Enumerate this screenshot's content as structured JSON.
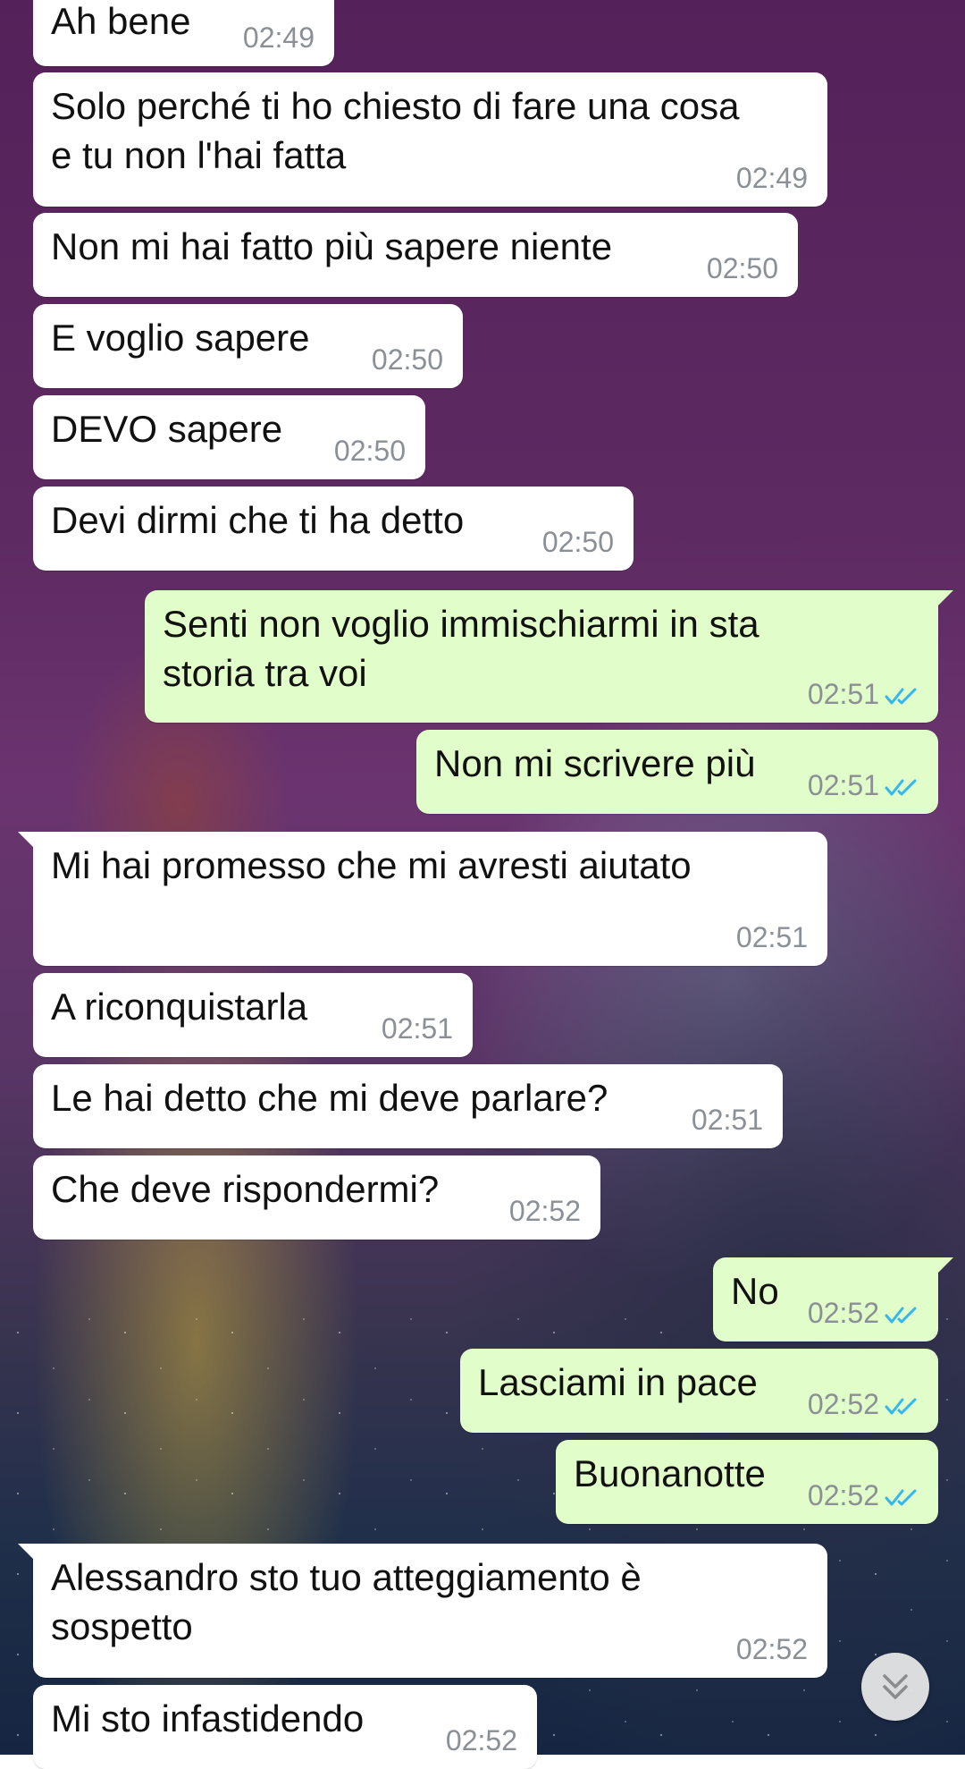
{
  "messages": [
    {
      "text": "Ah bene",
      "time": "02:49"
    },
    {
      "text": "Solo perché ti ho chiesto di fare una cosa\ne tu non l'hai fatta",
      "time": "02:49"
    },
    {
      "text": "Non mi hai fatto più sapere niente",
      "time": "02:50"
    },
    {
      "text": "E voglio sapere",
      "time": "02:50"
    },
    {
      "text": "DEVO sapere",
      "time": "02:50"
    },
    {
      "text": "Devi dirmi che ti ha detto",
      "time": "02:50"
    },
    {
      "text": "Senti non voglio immischiarmi in sta\nstoria tra voi",
      "time": "02:51",
      "status": "read"
    },
    {
      "text": "Non mi scrivere più",
      "time": "02:51",
      "status": "read"
    },
    {
      "text": "Mi hai promesso che mi avresti aiutato",
      "time": "02:51"
    },
    {
      "text": "A riconquistarla",
      "time": "02:51"
    },
    {
      "text": "Le hai detto che mi deve parlare?",
      "time": "02:51"
    },
    {
      "text": "Che deve rispondermi?",
      "time": "02:52"
    },
    {
      "text": "No",
      "time": "02:52",
      "status": "read"
    },
    {
      "text": "Lasciami in pace",
      "time": "02:52",
      "status": "read"
    },
    {
      "text": "Buonanotte",
      "time": "02:52",
      "status": "read"
    },
    {
      "text": "Alessandro sto tuo atteggiamento è\nsospetto",
      "time": "02:52"
    },
    {
      "text": "Mi sto infastidendo",
      "time": "02:52"
    }
  ],
  "icons": {
    "read_receipt": "double-check-icon",
    "scroll_button": "double-chevron-down-icon"
  },
  "colors": {
    "incoming_bubble": "#ffffff",
    "outgoing_bubble": "#e1fdc9",
    "read_ticks": "#34b7f1",
    "timestamp": "#8a9095"
  }
}
